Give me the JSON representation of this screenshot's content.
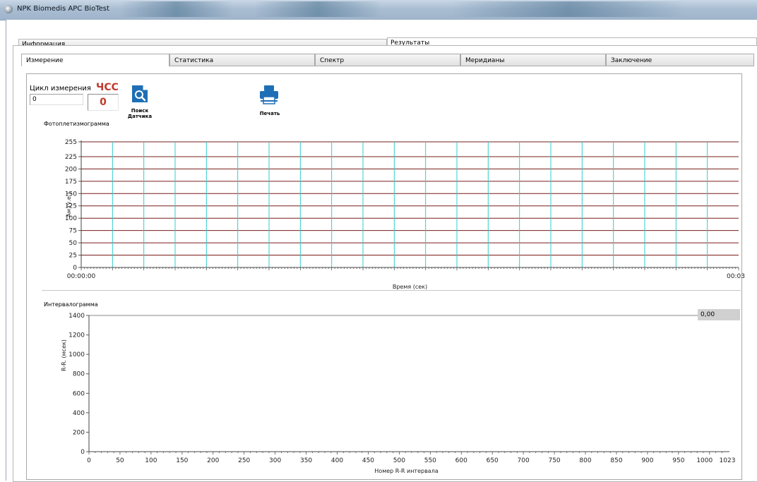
{
  "window": {
    "title": "NPK Biomedis APC BioTest"
  },
  "top_tabs": [
    {
      "label": "Информация"
    },
    {
      "label": "Результаты"
    }
  ],
  "sub_tabs": [
    {
      "label": "Измерение"
    },
    {
      "label": "Статистика"
    },
    {
      "label": "Спектр"
    },
    {
      "label": "Меридианы"
    },
    {
      "label": "Заключение"
    }
  ],
  "controls": {
    "cycle_label": "Цикл измерения",
    "cycle_value": "0",
    "hr_label": "ЧСС",
    "hr_value": "0",
    "find_sensor_line1": "Поиск",
    "find_sensor_line2": "Датчика",
    "print_label": "Печать"
  },
  "icons": {
    "find_sensor": "search-document-icon",
    "print": "printer-icon",
    "app": "app-icon"
  },
  "colors": {
    "accent_red": "#c0392b",
    "icon_blue": "#1e6fb5",
    "grid_h": "#7a1c1c",
    "grid_v": "#33cccc"
  },
  "chart_data": [
    {
      "type": "line",
      "title": "Фотоплетизмограмма",
      "xlabel": "Время (сек)",
      "ylabel": "Ам (у.е.)",
      "ylim": [
        0,
        255
      ],
      "yticks": [
        "255",
        "225",
        "200",
        "175",
        "150",
        "125",
        "100",
        "75",
        "50",
        "25",
        "0"
      ],
      "xticks": [
        "00:00:00",
        "00:03"
      ],
      "grid": true,
      "series": []
    },
    {
      "type": "line",
      "title": "Интервалограмма",
      "xlabel": "Номер R-R интервала",
      "ylabel": "R-R. (мсек)",
      "ylim": [
        0,
        1400
      ],
      "xlim": [
        0,
        1023
      ],
      "yticks": [
        "1400",
        "1200",
        "1000",
        "800",
        "600",
        "400",
        "200",
        "0"
      ],
      "xticks": [
        "0",
        "50",
        "100",
        "150",
        "200",
        "250",
        "300",
        "350",
        "400",
        "450",
        "500",
        "550",
        "600",
        "650",
        "700",
        "750",
        "800",
        "850",
        "900",
        "950",
        "1000",
        "1023"
      ],
      "readout": "0,00",
      "series": []
    }
  ]
}
